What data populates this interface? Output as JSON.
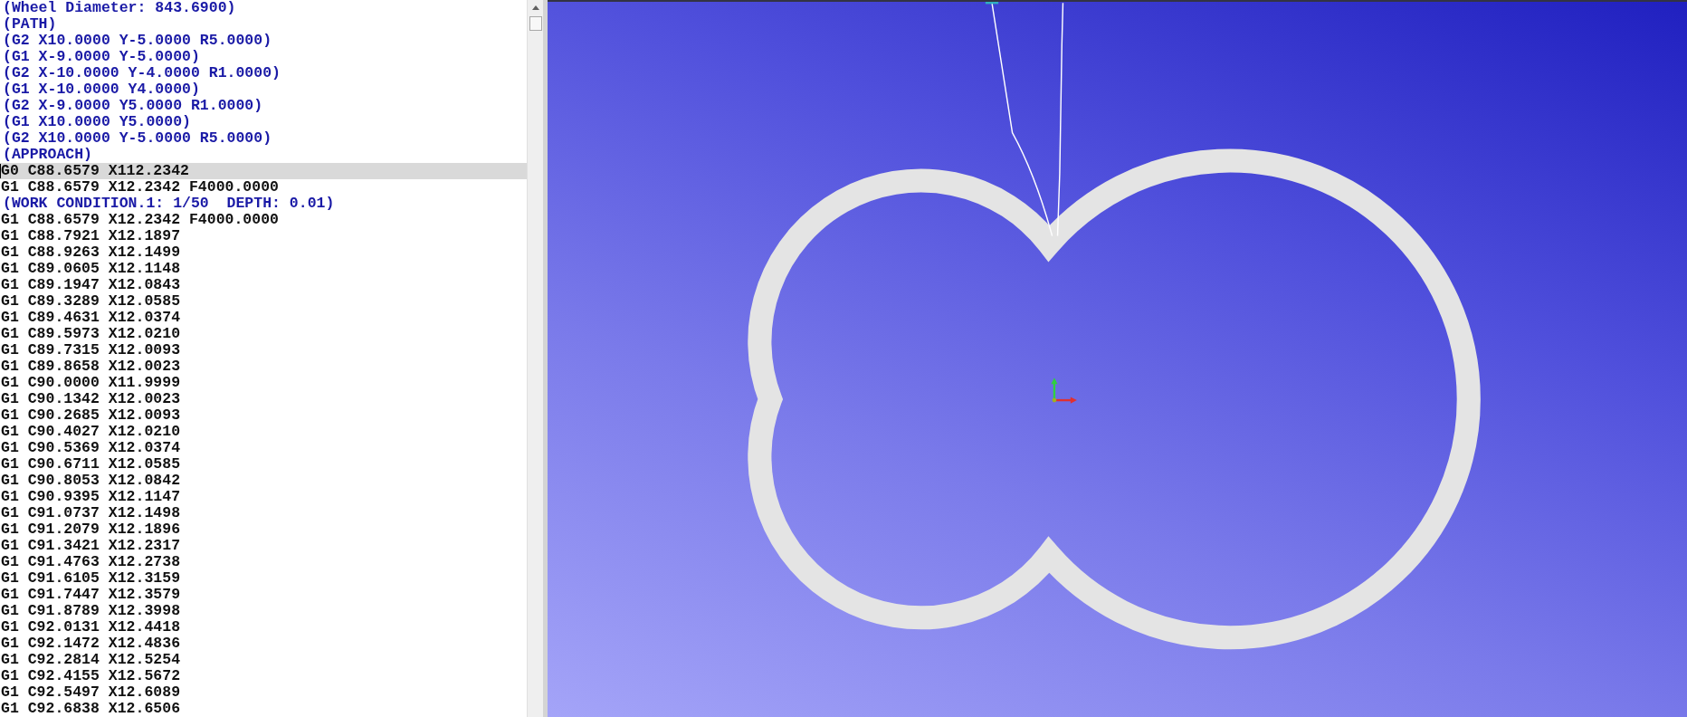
{
  "editor": {
    "lines": [
      {
        "text": "(Wheel Diameter: 843.6900)",
        "kind": "comment",
        "selected": false
      },
      {
        "text": "(PATH)",
        "kind": "comment",
        "selected": false
      },
      {
        "text": "(G2 X10.0000 Y-5.0000 R5.0000)",
        "kind": "comment",
        "selected": false
      },
      {
        "text": "(G1 X-9.0000 Y-5.0000)",
        "kind": "comment",
        "selected": false
      },
      {
        "text": "(G2 X-10.0000 Y-4.0000 R1.0000)",
        "kind": "comment",
        "selected": false
      },
      {
        "text": "(G1 X-10.0000 Y4.0000)",
        "kind": "comment",
        "selected": false
      },
      {
        "text": "(G2 X-9.0000 Y5.0000 R1.0000)",
        "kind": "comment",
        "selected": false
      },
      {
        "text": "(G1 X10.0000 Y5.0000)",
        "kind": "comment",
        "selected": false
      },
      {
        "text": "(G2 X10.0000 Y-5.0000 R5.0000)",
        "kind": "comment",
        "selected": false
      },
      {
        "text": "(APPROACH)",
        "kind": "comment",
        "selected": false
      },
      {
        "text": "G0 C88.6579 X112.2342",
        "kind": "code",
        "selected": true
      },
      {
        "text": "G1 C88.6579 X12.2342 F4000.0000",
        "kind": "code",
        "selected": false
      },
      {
        "text": "(WORK CONDITION.1: 1/50  DEPTH: 0.01)",
        "kind": "comment",
        "selected": false
      },
      {
        "text": "G1 C88.6579 X12.2342 F4000.0000",
        "kind": "code",
        "selected": false
      },
      {
        "text": "G1 C88.7921 X12.1897",
        "kind": "code",
        "selected": false
      },
      {
        "text": "G1 C88.9263 X12.1499",
        "kind": "code",
        "selected": false
      },
      {
        "text": "G1 C89.0605 X12.1148",
        "kind": "code",
        "selected": false
      },
      {
        "text": "G1 C89.1947 X12.0843",
        "kind": "code",
        "selected": false
      },
      {
        "text": "G1 C89.3289 X12.0585",
        "kind": "code",
        "selected": false
      },
      {
        "text": "G1 C89.4631 X12.0374",
        "kind": "code",
        "selected": false
      },
      {
        "text": "G1 C89.5973 X12.0210",
        "kind": "code",
        "selected": false
      },
      {
        "text": "G1 C89.7315 X12.0093",
        "kind": "code",
        "selected": false
      },
      {
        "text": "G1 C89.8658 X12.0023",
        "kind": "code",
        "selected": false
      },
      {
        "text": "G1 C90.0000 X11.9999",
        "kind": "code",
        "selected": false
      },
      {
        "text": "G1 C90.1342 X12.0023",
        "kind": "code",
        "selected": false
      },
      {
        "text": "G1 C90.2685 X12.0093",
        "kind": "code",
        "selected": false
      },
      {
        "text": "G1 C90.4027 X12.0210",
        "kind": "code",
        "selected": false
      },
      {
        "text": "G1 C90.5369 X12.0374",
        "kind": "code",
        "selected": false
      },
      {
        "text": "G1 C90.6711 X12.0585",
        "kind": "code",
        "selected": false
      },
      {
        "text": "G1 C90.8053 X12.0842",
        "kind": "code",
        "selected": false
      },
      {
        "text": "G1 C90.9395 X12.1147",
        "kind": "code",
        "selected": false
      },
      {
        "text": "G1 C91.0737 X12.1498",
        "kind": "code",
        "selected": false
      },
      {
        "text": "G1 C91.2079 X12.1896",
        "kind": "code",
        "selected": false
      },
      {
        "text": "G1 C91.3421 X12.2317",
        "kind": "code",
        "selected": false
      },
      {
        "text": "G1 C91.4763 X12.2738",
        "kind": "code",
        "selected": false
      },
      {
        "text": "G1 C91.6105 X12.3159",
        "kind": "code",
        "selected": false
      },
      {
        "text": "G1 C91.7447 X12.3579",
        "kind": "code",
        "selected": false
      },
      {
        "text": "G1 C91.8789 X12.3998",
        "kind": "code",
        "selected": false
      },
      {
        "text": "G1 C92.0131 X12.4418",
        "kind": "code",
        "selected": false
      },
      {
        "text": "G1 C92.1472 X12.4836",
        "kind": "code",
        "selected": false
      },
      {
        "text": "G1 C92.2814 X12.5254",
        "kind": "code",
        "selected": false
      },
      {
        "text": "G1 C92.4155 X12.5672",
        "kind": "code",
        "selected": false
      },
      {
        "text": "G1 C92.5497 X12.6089",
        "kind": "code",
        "selected": false
      },
      {
        "text": "G1 C92.6838 X12.6506",
        "kind": "code",
        "selected": false
      }
    ]
  }
}
